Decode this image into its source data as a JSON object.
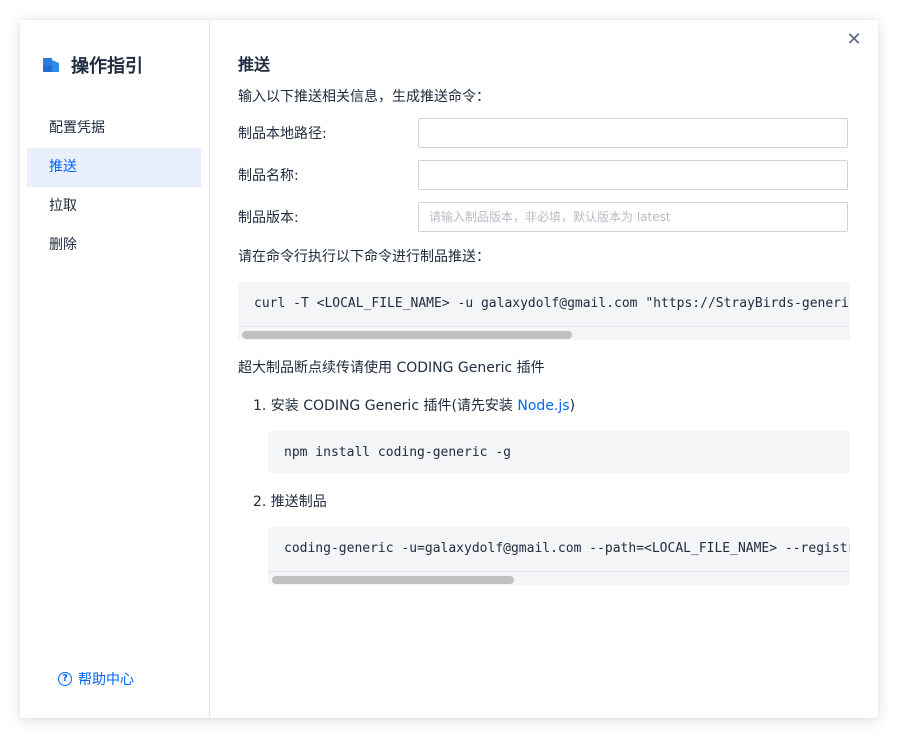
{
  "sidebar": {
    "title": "操作指引",
    "items": [
      {
        "label": "配置凭据"
      },
      {
        "label": "推送"
      },
      {
        "label": "拉取"
      },
      {
        "label": "删除"
      }
    ],
    "active_index": 1,
    "help_label": "帮助中心"
  },
  "main": {
    "title": "推送",
    "intro": "输入以下推送相关信息，生成推送命令：",
    "fields": [
      {
        "label": "制品本地路径:",
        "value": "",
        "placeholder": ""
      },
      {
        "label": "制品名称:",
        "value": "",
        "placeholder": ""
      },
      {
        "label": "制品版本:",
        "value": "",
        "placeholder": "请输入制品版本，非必填，默认版本为 latest"
      }
    ],
    "command_title": "请在命令行执行以下命令进行制品推送：",
    "command": "curl -T <LOCAL_FILE_NAME> -u galaxydolf@gmail.com \"https://StrayBirds-generic.pkg.coding.net/project/repo/chunks/<FILE_NAME>?version=latest\"",
    "plugin_title": "超大制品断点续传请使用 CODING Generic 插件",
    "step1_prefix": "1. 安装 CODING Generic 插件(请先安装 ",
    "step1_link": "Node.js",
    "step1_suffix": ")",
    "step1_command": "npm install coding-generic -g",
    "step2_label": "2. 推送制品",
    "step2_command": "coding-generic -u=galaxydolf@gmail.com --path=<LOCAL_FILE_NAME> --registry=\"https://StrayBirds-generic.pkg.coding.net/project/repo/chunks/<FILE_NAME>?version=latest\""
  },
  "colors": {
    "accent": "#0066ff",
    "active_bg": "#e9effd",
    "text": "#202d40",
    "code_bg": "#f4f5f7"
  },
  "icons": {
    "title_icon": "book-icon",
    "close_icon": "close-icon",
    "help_icon": "question-circle-icon"
  }
}
